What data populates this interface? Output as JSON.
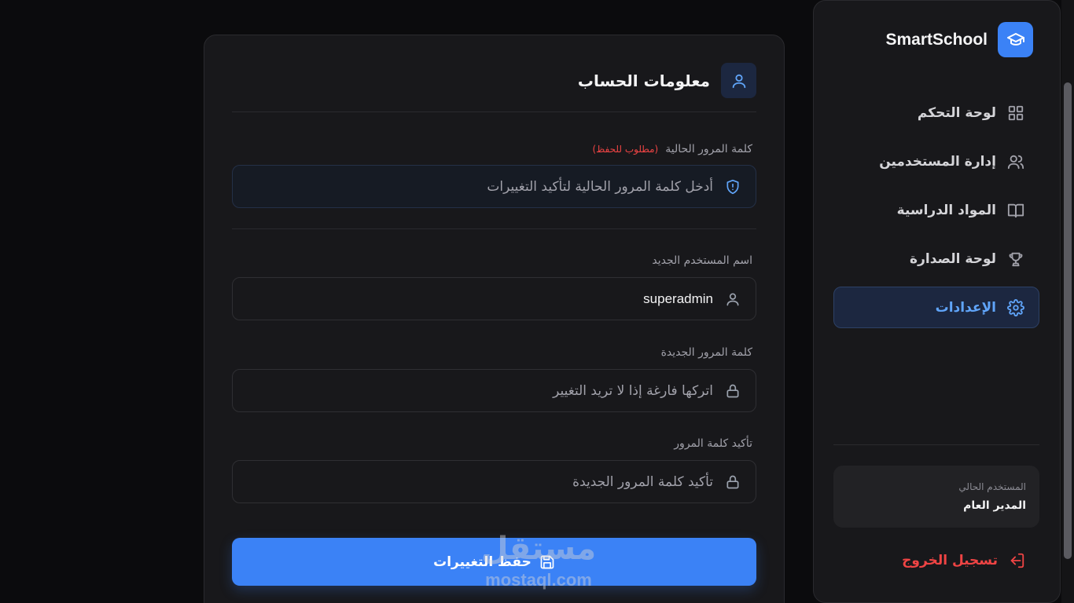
{
  "sidebar": {
    "brand": "SmartSchool",
    "nav": [
      {
        "label": "لوحة التحكم",
        "icon": "grid-icon"
      },
      {
        "label": "إدارة المستخدمين",
        "icon": "users-icon"
      },
      {
        "label": "المواد الدراسية",
        "icon": "book-icon"
      },
      {
        "label": "لوحة الصدارة",
        "icon": "trophy-icon"
      },
      {
        "label": "الإعدادات",
        "icon": "gear-icon",
        "active": true
      }
    ],
    "current_user_label": "المستخدم الحالي",
    "current_user_name": "المدير العام",
    "logout_label": "تسجيل الخروج"
  },
  "card": {
    "title": "معلومات الحساب",
    "current_password": {
      "label": "كلمة المرور الحالية",
      "required_note": "(مطلوب للحفظ)",
      "placeholder": "أدخل كلمة المرور الحالية لتأكيد التغييرات"
    },
    "new_username": {
      "label": "اسم المستخدم الجديد",
      "value": "superadmin"
    },
    "new_password": {
      "label": "كلمة المرور الجديدة",
      "placeholder": "اتركها فارغة إذا لا تريد التغيير"
    },
    "confirm_password": {
      "label": "تأكيد كلمة المرور",
      "placeholder": "تأكيد كلمة المرور الجديدة"
    },
    "save_label": "حفظ التغييرات"
  },
  "watermark": {
    "arabic": "مستقل",
    "latin": "mostaql.com"
  },
  "colors": {
    "accent": "#3b82f6",
    "accent_text": "#60a5fa",
    "danger": "#ef4444",
    "background": "#0b0b0d",
    "surface": "#18181b"
  }
}
